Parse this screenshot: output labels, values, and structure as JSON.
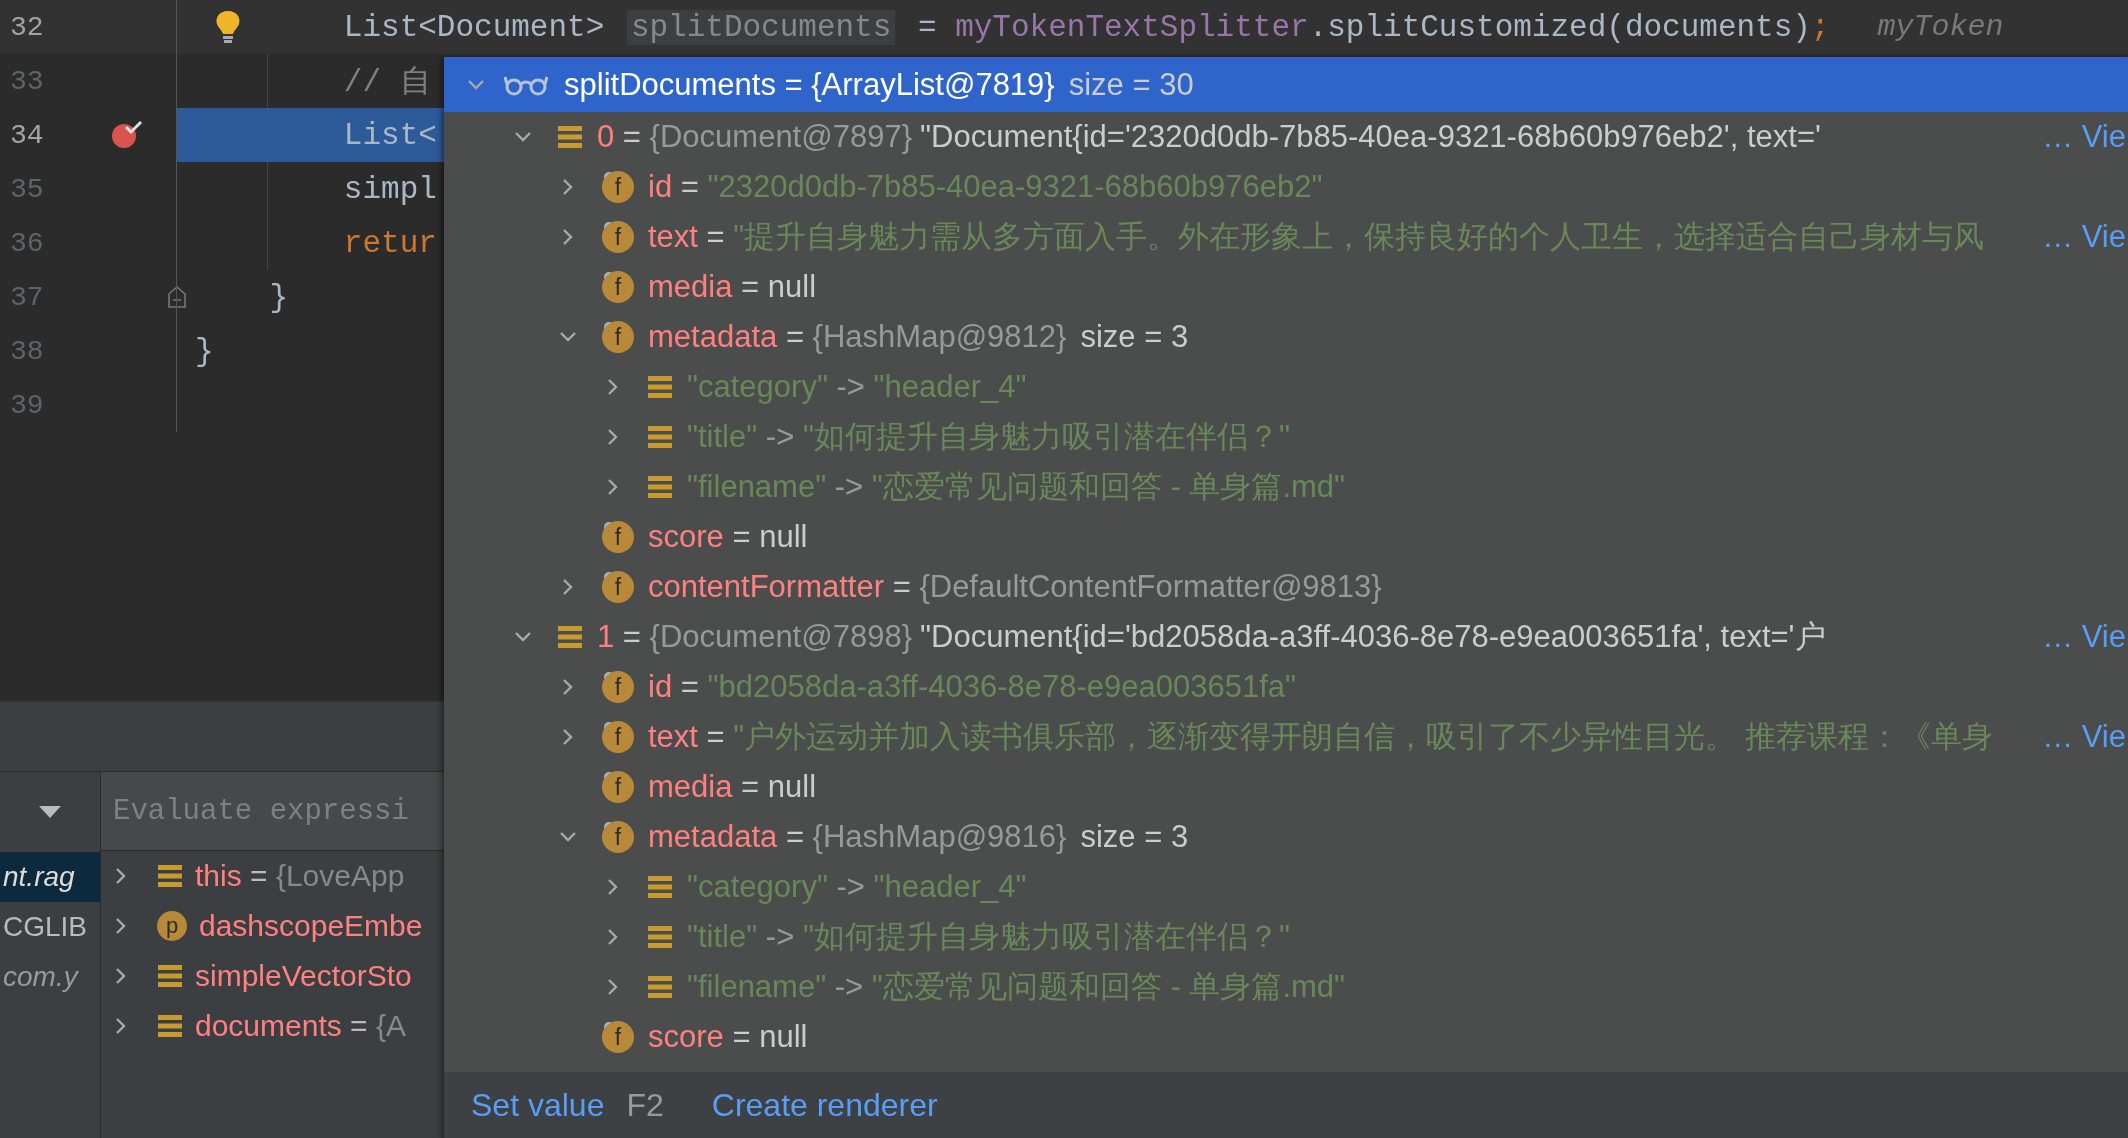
{
  "editor": {
    "lines": [
      {
        "number": "32",
        "intention_bulb": true,
        "caret": true,
        "current": false,
        "tokens": [
          {
            "kind": "plain",
            "text": "        List<Document> "
          },
          {
            "kind": "highlight",
            "text": "splitDocuments"
          },
          {
            "kind": "plain",
            "text": " = "
          },
          {
            "kind": "field",
            "text": "myTokenTextSplitter"
          },
          {
            "kind": "plain",
            "text": ".splitCustomized(documents)"
          },
          {
            "kind": "keyword",
            "text": ";"
          },
          {
            "kind": "hint",
            "text": "myToken"
          }
        ]
      },
      {
        "number": "33",
        "caret": false,
        "current": false,
        "tokens": [
          {
            "kind": "comment",
            "text": "        // 自"
          }
        ]
      },
      {
        "number": "34",
        "breakpoint": true,
        "caret": false,
        "current": true,
        "tokens": [
          {
            "kind": "plain",
            "text": "        List<"
          }
        ]
      },
      {
        "number": "35",
        "caret": false,
        "current": false,
        "tokens": [
          {
            "kind": "plain",
            "text": "        simpl"
          }
        ]
      },
      {
        "number": "36",
        "caret": false,
        "current": false,
        "tokens": [
          {
            "kind": "keyword",
            "text": "        retur"
          }
        ]
      },
      {
        "number": "37",
        "fold_marker": true,
        "caret": false,
        "current": false,
        "tokens": [
          {
            "kind": "plain",
            "text": "    }"
          }
        ]
      },
      {
        "number": "38",
        "caret": false,
        "current": false,
        "tokens": [
          {
            "kind": "plain",
            "text": "}"
          }
        ]
      },
      {
        "number": "39",
        "caret": false,
        "current": false
      }
    ]
  },
  "debugger": {
    "evaluate": {
      "placeholder": "Evaluate expressi"
    },
    "frames": [
      {
        "text": "nt.rag",
        "selected": true,
        "italic": true
      },
      {
        "text": "CGLIB",
        "selected": false,
        "italic": false
      },
      {
        "text": "com.y",
        "selected": false,
        "italic": true
      }
    ],
    "variables": [
      {
        "kind": "list",
        "name": "this",
        "sep": " = ",
        "ref": "{LoveApp",
        "expanded": false
      },
      {
        "kind": "param",
        "badge": "p",
        "name": "dashscopeEmbe",
        "expanded": false
      },
      {
        "kind": "list",
        "name": "simpleVectorSto",
        "expanded": false
      },
      {
        "kind": "list",
        "name": "documents",
        "sep": " = ",
        "ref": "{A",
        "expanded": false
      }
    ]
  },
  "popup": {
    "header": {
      "name": "splitDocuments",
      "sep": " = ",
      "ref": "{ArrayList@7819}",
      "size": "size = 30",
      "expanded": true
    },
    "nodes": [
      {
        "kind": "element",
        "name": "0",
        "sep": " = ",
        "ref": "{Document@7897}",
        "value": "\"Document{id='2320d0db-7b85-40ea-9321-68b60b976eb2', text='",
        "link": "… Vie",
        "expanded": true,
        "children": [
          {
            "kind": "field",
            "badge": "f",
            "name": "id",
            "sep": " = ",
            "string": "\"2320d0db-7b85-40ea-9321-68b60b976eb2\"",
            "expanded": false
          },
          {
            "kind": "field",
            "badge": "f",
            "name": "text",
            "sep": " = ",
            "string": "\"提升自身魅力需从多方面入手。外在形象上，保持良好的个人卫生，选择适合自己身材与风",
            "link": "… Vie",
            "expanded": false
          },
          {
            "kind": "field",
            "badge": "f",
            "name": "media",
            "sep": " = ",
            "value": "null"
          },
          {
            "kind": "field",
            "badge": "f",
            "name": "metadata",
            "sep": " = ",
            "ref": "{HashMap@9812}",
            "size": "size = 3",
            "expanded": true,
            "children": [
              {
                "kind": "entry",
                "name": "\"category\"",
                "sep": " -> ",
                "string": "\"header_4\"",
                "expanded": false
              },
              {
                "kind": "entry",
                "name": "\"title\"",
                "sep": " -> ",
                "string": "\"如何提升自身魅力吸引潜在伴侣？\"",
                "expanded": false
              },
              {
                "kind": "entry",
                "name": "\"filename\"",
                "sep": " -> ",
                "string": "\"恋爱常见问题和回答 - 单身篇.md\"",
                "expanded": false
              }
            ]
          },
          {
            "kind": "field",
            "badge": "f",
            "name": "score",
            "sep": " = ",
            "value": "null"
          },
          {
            "kind": "field",
            "badge": "f",
            "name": "contentFormatter",
            "sep": " = ",
            "ref": "{DefaultContentFormatter@9813}",
            "expanded": false
          }
        ]
      },
      {
        "kind": "element",
        "name": "1",
        "sep": " = ",
        "ref": "{Document@7898}",
        "value": "\"Document{id='bd2058da-a3ff-4036-8e78-e9ea003651fa', text='户",
        "link": "… Vie",
        "expanded": true,
        "children": [
          {
            "kind": "field",
            "badge": "f",
            "name": "id",
            "sep": " = ",
            "string": "\"bd2058da-a3ff-4036-8e78-e9ea003651fa\"",
            "expanded": false
          },
          {
            "kind": "field",
            "badge": "f",
            "name": "text",
            "sep": " = ",
            "string": "\"户外运动并加入读书俱乐部，逐渐变得开朗自信，吸引了不少异性目光。 推荐课程：《单身",
            "link": "… Vie",
            "expanded": false
          },
          {
            "kind": "field",
            "badge": "f",
            "name": "media",
            "sep": " = ",
            "value": "null"
          },
          {
            "kind": "field",
            "badge": "f",
            "name": "metadata",
            "sep": " = ",
            "ref": "{HashMap@9816}",
            "size": "size = 3",
            "expanded": true,
            "children": [
              {
                "kind": "entry",
                "name": "\"category\"",
                "sep": " -> ",
                "string": "\"header_4\"",
                "expanded": false
              },
              {
                "kind": "entry",
                "name": "\"title\"",
                "sep": " -> ",
                "string": "\"如何提升自身魅力吸引潜在伴侣？\"",
                "expanded": false
              },
              {
                "kind": "entry",
                "name": "\"filename\"",
                "sep": " -> ",
                "string": "\"恋爱常见问题和回答 - 单身篇.md\"",
                "expanded": false
              }
            ]
          },
          {
            "kind": "field",
            "badge": "f",
            "name": "score",
            "sep": " = ",
            "value": "null"
          }
        ]
      }
    ],
    "actions": [
      {
        "label": "Set value",
        "shortcut": "F2"
      },
      {
        "label": "Create renderer"
      }
    ]
  }
}
